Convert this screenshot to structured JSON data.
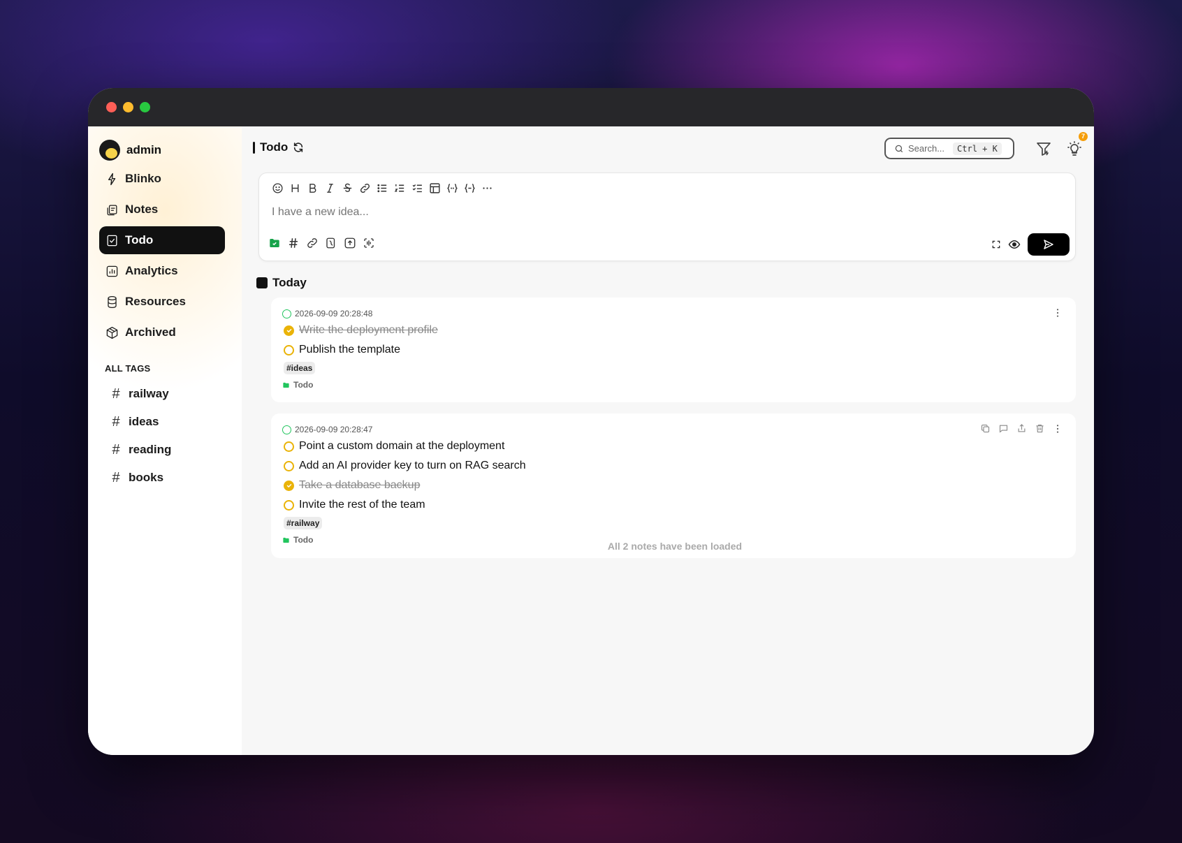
{
  "user": {
    "name": "admin"
  },
  "nav": [
    {
      "label": "Blinko",
      "icon": "lightning-icon"
    },
    {
      "label": "Notes",
      "icon": "notes-icon"
    },
    {
      "label": "Todo",
      "icon": "todo-icon",
      "active": true
    },
    {
      "label": "Analytics",
      "icon": "analytics-icon"
    },
    {
      "label": "Resources",
      "icon": "database-icon"
    },
    {
      "label": "Archived",
      "icon": "box-icon"
    }
  ],
  "tags": {
    "title": "ALL TAGS",
    "items": [
      "railway",
      "ideas",
      "reading",
      "books"
    ]
  },
  "header": {
    "title": "Todo",
    "search_placeholder": "Search...",
    "shortcut": "Ctrl + K",
    "notification_count": "7"
  },
  "editor": {
    "placeholder": "I have a new idea..."
  },
  "section": {
    "title": "Today"
  },
  "notes": [
    {
      "date": "2026-09-09 20:28:48",
      "tasks": [
        {
          "text": "Write the deployment profile",
          "done": true
        },
        {
          "text": "Publish the template",
          "done": false
        }
      ],
      "tag": "#ideas",
      "folder": "Todo"
    },
    {
      "date": "2026-09-09 20:28:47",
      "tasks": [
        {
          "text": "Point a custom domain at the deployment",
          "done": false
        },
        {
          "text": "Add an AI provider key to turn on RAG search",
          "done": false
        },
        {
          "text": "Take a database backup",
          "done": true
        },
        {
          "text": "Invite the rest of the team",
          "done": false
        }
      ],
      "tag": "#railway",
      "folder": "Todo"
    }
  ],
  "footer": {
    "loaded_text": "All 2 notes have been loaded"
  },
  "colors": {
    "accent": "#eab308",
    "folder": "#22c55e",
    "badge": "#f59e0b"
  }
}
